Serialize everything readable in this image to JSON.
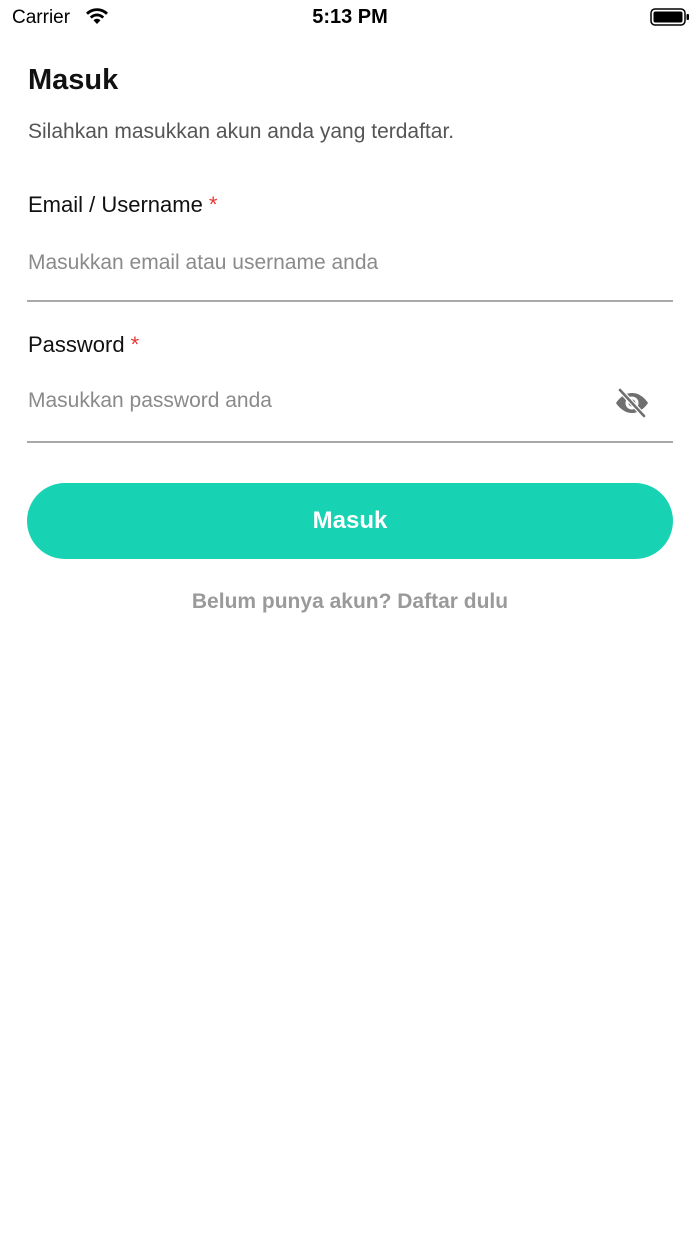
{
  "status_bar": {
    "carrier": "Carrier",
    "time": "5:13 PM"
  },
  "header": {
    "title": "Masuk",
    "subtitle": "Silahkan masukkan akun anda yang terdaftar."
  },
  "form": {
    "email": {
      "label": "Email / Username",
      "required_mark": "*",
      "value": "",
      "placeholder": "Masukkan email atau username anda"
    },
    "password": {
      "label": "Password",
      "required_mark": "*",
      "value": "",
      "placeholder": "Masukkan password anda",
      "toggle_icon": "eye-off-icon"
    },
    "submit_label": "Masuk",
    "register_link": "Belum punya akun? Daftar dulu"
  },
  "colors": {
    "accent": "#18d2b4",
    "required": "#e53935",
    "muted_text": "#9a9a9a"
  }
}
